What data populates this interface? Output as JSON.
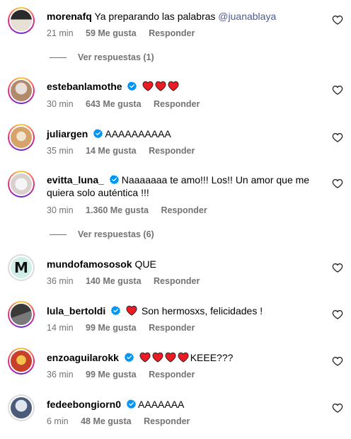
{
  "comments": [
    {
      "user": "morenafq",
      "verified": false,
      "text": "Ya preparando las palabras ",
      "mention": "@juanablaya",
      "time": "21 min",
      "likes": "59 Me gusta",
      "reply": "Responder",
      "avatar_colors": [
        "#2a2a2a",
        "#e9e0d5"
      ]
    },
    {
      "user": "estebanlamothe",
      "verified": true,
      "text": "",
      "hearts": 3,
      "time": "30 min",
      "likes": "643 Me gusta",
      "reply": "Responder",
      "avatar_colors": [
        "#b08a6a",
        "#e8e0d8"
      ]
    },
    {
      "user": "juliargen",
      "verified": true,
      "text": "AAAAAAAAAA",
      "time": "35 min",
      "likes": "14 Me gusta",
      "reply": "Responder",
      "avatar_colors": [
        "#d6a46a",
        "#f3e4cf"
      ]
    },
    {
      "user": "evitta_luna_",
      "verified": true,
      "text_line1": "Naaaaaaa te amo!!! Los!! Un amor que me",
      "text_line2": "quiera solo auténtica !!!",
      "time": "30 min",
      "likes": "1.360 Me gusta",
      "reply": "Responder",
      "avatar_colors": [
        "#d8d0cc",
        "#f5f5f5"
      ]
    },
    {
      "user": "mundofamososok",
      "verified": false,
      "text": "QUE",
      "time": "36 min",
      "likes": "140 Me gusta",
      "reply": "Responder",
      "avatar_letter": "M"
    },
    {
      "user": "lula_bertoldi",
      "verified": true,
      "text": "Son hermosxs, felicidades !",
      "hearts_before": 1,
      "time": "14 min",
      "likes": "99 Me gusta",
      "reply": "Responder",
      "avatar_colors": [
        "#3a3a3a",
        "#7a7a7a"
      ]
    },
    {
      "user": "enzoaguilarokk",
      "verified": true,
      "text": "KEEE???",
      "hearts_before": 4,
      "time": "36 min",
      "likes": "99 Me gusta",
      "reply": "Responder",
      "avatar_colors": [
        "#c8402a",
        "#f2c14e"
      ]
    },
    {
      "user": "fedeebongiorn0",
      "verified": true,
      "text": "AAAAAAA",
      "time": "6 min",
      "likes": "48 Me gusta",
      "reply": "Responder",
      "avatar_colors": [
        "#4b5c7a",
        "#dfe6ee"
      ]
    }
  ],
  "view_replies": [
    "Ver respuestas (1)",
    "Ver respuestas (6)"
  ],
  "colors": {
    "accent_blue": "#0095f6",
    "heart_red": "#ed1c24",
    "meta_gray": "#737373",
    "mention": "#4f5b93"
  }
}
